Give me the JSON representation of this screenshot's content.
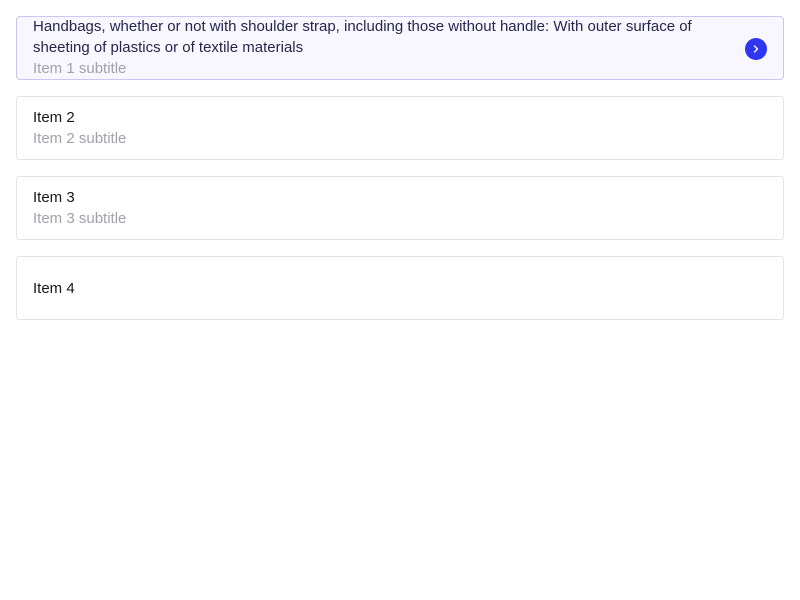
{
  "items": [
    {
      "title": "Handbags, whether or not with shoulder strap, including those without handle: With outer surface of sheeting of plastics or of textile materials",
      "subtitle": "Item 1 subtitle",
      "selected": true,
      "action_icon": "chevron-right-icon"
    },
    {
      "title": "Item 2",
      "subtitle": "Item 2 subtitle",
      "selected": false
    },
    {
      "title": "Item 3",
      "subtitle": "Item 3 subtitle",
      "selected": false
    },
    {
      "title": "Item 4",
      "subtitle": "",
      "selected": false
    }
  ],
  "colors": {
    "accent": "#2f36f2",
    "selected_bg": "#f8f7ff",
    "selected_border": "#c9c8f2",
    "border": "#e4e4e7",
    "title": "#18181b",
    "subtitle": "#a1a1aa"
  }
}
